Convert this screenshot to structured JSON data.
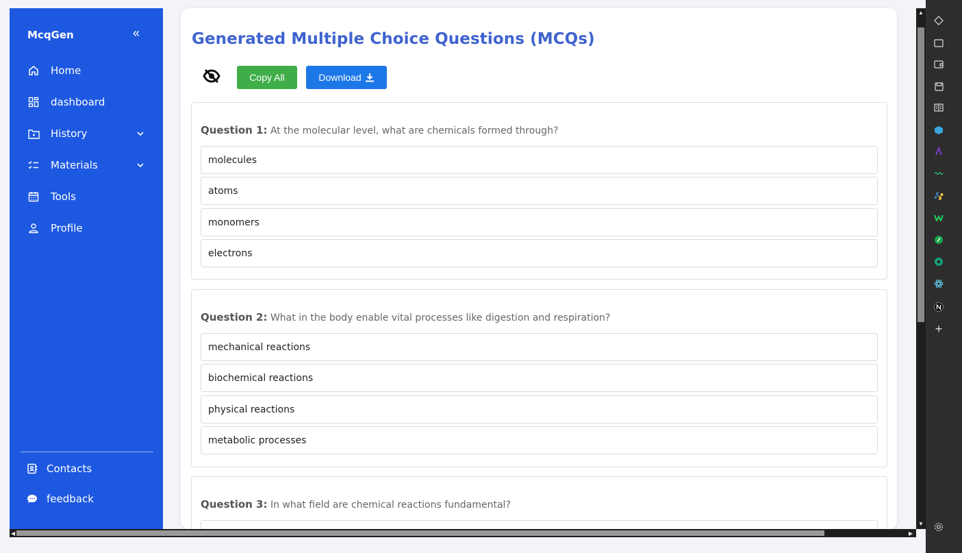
{
  "sidebar": {
    "brand": "McqGen",
    "collapse_icon": "«",
    "items": [
      {
        "label": "Home",
        "icon": "home-icon"
      },
      {
        "label": "dashboard",
        "icon": "dashboard-icon"
      },
      {
        "label": "History",
        "icon": "history-icon",
        "expandable": true
      },
      {
        "label": "Materials",
        "icon": "materials-icon",
        "expandable": true
      },
      {
        "label": "Tools",
        "icon": "calendar-icon"
      },
      {
        "label": "Profile",
        "icon": "user-icon"
      }
    ],
    "footer": [
      {
        "label": "Contacts",
        "icon": "contacts-icon"
      },
      {
        "label": "feedback",
        "icon": "chat-icon"
      }
    ],
    "color": "#1d58e0"
  },
  "main": {
    "title": "Generated Multiple Choice Questions (MCQs)",
    "copy_label": "Copy All",
    "download_label": "Download",
    "questions": [
      {
        "label": "Question 1:",
        "text": "At the molecular level, what are chemicals formed through?",
        "options": [
          "molecules",
          "atoms",
          "monomers",
          "electrons"
        ]
      },
      {
        "label": "Question 2:",
        "text": "What in the body enable vital processes like digestion and respiration?",
        "options": [
          "mechanical reactions",
          "biochemical reactions",
          "physical reactions",
          "metabolic processes"
        ]
      },
      {
        "label": "Question 3:",
        "text": "In what field are chemical reactions fundamental?",
        "options": []
      }
    ]
  },
  "colors": {
    "title": "#3f63cf",
    "copy_button": "#3fae49",
    "download_button": "#1c78e6"
  }
}
